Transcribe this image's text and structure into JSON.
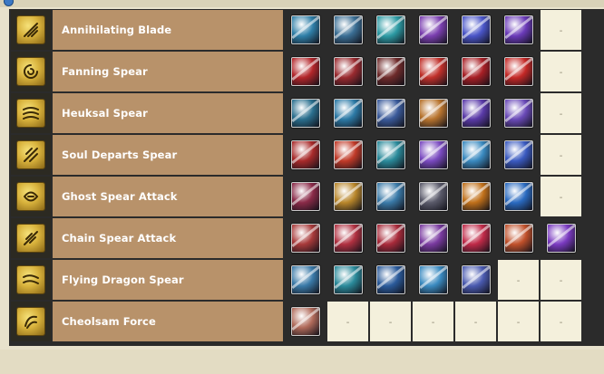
{
  "colors": {
    "name_bg": "#b8926a",
    "table_bg": "#2b2b2b",
    "empty_cell_bg": "#f4f0dc",
    "class_icon_gold": "#d8b23c"
  },
  "empty_marker": "-",
  "skills": [
    {
      "name": "Annihilating Blade",
      "icons": [
        {
          "icon": "annihilating-blade-skill-1-icon",
          "color": "#2f7fa8"
        },
        {
          "icon": "annihilating-blade-skill-2-icon",
          "color": "#3a6e94"
        },
        {
          "icon": "annihilating-blade-skill-3-icon",
          "color": "#2c9aa3"
        },
        {
          "icon": "annihilating-blade-skill-4-icon",
          "color": "#7b3fb0"
        },
        {
          "icon": "annihilating-blade-skill-5-icon",
          "color": "#4a55c8"
        },
        {
          "icon": "annihilating-blade-skill-6-icon",
          "color": "#6a3ab8"
        }
      ]
    },
    {
      "name": "Fanning Spear",
      "icons": [
        {
          "icon": "fanning-spear-skill-1-icon",
          "color": "#b3262a"
        },
        {
          "icon": "fanning-spear-skill-2-icon",
          "color": "#9a2a2f"
        },
        {
          "icon": "fanning-spear-skill-3-icon",
          "color": "#6e2a2a"
        },
        {
          "icon": "fanning-spear-skill-4-icon",
          "color": "#c0302a"
        },
        {
          "icon": "fanning-spear-skill-5-icon",
          "color": "#a81f25"
        },
        {
          "icon": "fanning-spear-skill-6-icon",
          "color": "#c42826"
        }
      ]
    },
    {
      "name": "Heuksal Spear",
      "icons": [
        {
          "icon": "heuksal-spear-skill-1-icon",
          "color": "#2a6f8e"
        },
        {
          "icon": "heuksal-spear-skill-2-icon",
          "color": "#2c7aa6"
        },
        {
          "icon": "heuksal-spear-skill-3-icon",
          "color": "#3a5a9a"
        },
        {
          "icon": "heuksal-spear-skill-4-icon",
          "color": "#b8742e"
        },
        {
          "icon": "heuksal-spear-skill-5-icon",
          "color": "#5a3aa8"
        },
        {
          "icon": "heuksal-spear-skill-6-icon",
          "color": "#6a4ab8"
        }
      ]
    },
    {
      "name": "Soul Departs Spear",
      "icons": [
        {
          "icon": "soul-departs-spear-skill-1-icon",
          "color": "#a82a2a"
        },
        {
          "icon": "soul-departs-spear-skill-2-icon",
          "color": "#c03a28"
        },
        {
          "icon": "soul-departs-spear-skill-3-icon",
          "color": "#2a8a9a"
        },
        {
          "icon": "soul-departs-spear-skill-4-icon",
          "color": "#7a4ac0"
        },
        {
          "icon": "soul-departs-spear-skill-5-icon",
          "color": "#3a8ac0"
        },
        {
          "icon": "soul-departs-spear-skill-6-icon",
          "color": "#3a5ac0"
        }
      ]
    },
    {
      "name": "Ghost Spear Attack",
      "icons": [
        {
          "icon": "ghost-spear-attack-skill-1-icon",
          "color": "#8a2a48"
        },
        {
          "icon": "ghost-spear-attack-skill-2-icon",
          "color": "#b8862a"
        },
        {
          "icon": "ghost-spear-attack-skill-3-icon",
          "color": "#3a7aa8"
        },
        {
          "icon": "ghost-spear-attack-skill-4-icon",
          "color": "#5a5a6a"
        },
        {
          "icon": "ghost-spear-attack-skill-5-icon",
          "color": "#c0701a"
        },
        {
          "icon": "ghost-spear-attack-skill-6-icon",
          "color": "#2a6ac0"
        }
      ]
    },
    {
      "name": "Chain Spear Attack",
      "icons": [
        {
          "icon": "chain-spear-attack-skill-1-icon",
          "color": "#a83a3a"
        },
        {
          "icon": "chain-spear-attack-skill-2-icon",
          "color": "#b03040"
        },
        {
          "icon": "chain-spear-attack-skill-3-icon",
          "color": "#a82a3a"
        },
        {
          "icon": "chain-spear-attack-skill-4-icon",
          "color": "#7a3aa0"
        },
        {
          "icon": "chain-spear-attack-skill-5-icon",
          "color": "#c02a48"
        },
        {
          "icon": "chain-spear-attack-skill-6-icon",
          "color": "#c0502a"
        },
        {
          "icon": "chain-spear-attack-skill-7-icon",
          "color": "#7a3ac0"
        }
      ]
    },
    {
      "name": "Flying Dragon Spear",
      "icons": [
        {
          "icon": "flying-dragon-spear-skill-1-icon",
          "color": "#3a7aa8"
        },
        {
          "icon": "flying-dragon-spear-skill-2-icon",
          "color": "#2a8a9a"
        },
        {
          "icon": "flying-dragon-spear-skill-3-icon",
          "color": "#2a5a9a"
        },
        {
          "icon": "flying-dragon-spear-skill-4-icon",
          "color": "#3a8ac0"
        },
        {
          "icon": "flying-dragon-spear-skill-5-icon",
          "color": "#4a5ab0"
        }
      ]
    },
    {
      "name": "Cheolsam Force",
      "icons": [
        {
          "icon": "cheolsam-force-skill-1-icon",
          "color": "#b06a5a"
        }
      ]
    }
  ]
}
